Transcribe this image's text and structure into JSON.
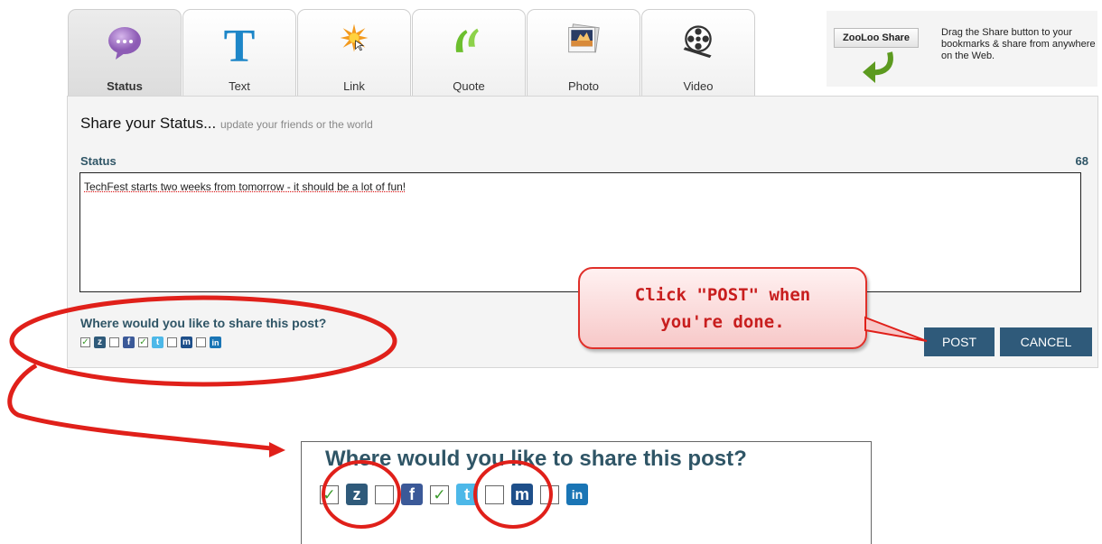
{
  "tabs": [
    {
      "label": "Status",
      "icon": "status-bubble-icon",
      "active": true
    },
    {
      "label": "Text",
      "icon": "text-t-icon",
      "active": false
    },
    {
      "label": "Link",
      "icon": "link-star-icon",
      "active": false
    },
    {
      "label": "Quote",
      "icon": "quote-marks-icon",
      "active": false
    },
    {
      "label": "Photo",
      "icon": "photo-icon",
      "active": false
    },
    {
      "label": "Video",
      "icon": "film-reel-icon",
      "active": false
    }
  ],
  "zooloo": {
    "button_label": "ZooLoo Share",
    "description": "Drag the Share button to your bookmarks & share from anywhere on the Web."
  },
  "form": {
    "heading": "Share your Status...",
    "subheading": "update your friends or the world",
    "status_label": "Status",
    "char_count": "68",
    "status_value": "TechFest starts two weeks from tomorrow - it should be a lot of fun!"
  },
  "share": {
    "question": "Where would you like to share this post?",
    "services": [
      {
        "name": "ZooLoo",
        "glyph": "z",
        "checked": true,
        "color": "#2f5a7a"
      },
      {
        "name": "Facebook",
        "glyph": "f",
        "checked": false,
        "color": "#3b5998"
      },
      {
        "name": "Twitter",
        "glyph": "t",
        "checked": true,
        "color": "#4db8e8"
      },
      {
        "name": "MySpace",
        "glyph": "m",
        "checked": false,
        "color": "#1e4f8a"
      },
      {
        "name": "LinkedIn",
        "glyph": "in",
        "checked": false,
        "color": "#1a75b5"
      }
    ]
  },
  "actions": {
    "post_label": "POST",
    "cancel_label": "CANCEL"
  },
  "callout": {
    "line1": "Click \"POST\" when",
    "line2": "you're done."
  },
  "zoom": {
    "question": "Where would you like to share this post?"
  },
  "colors": {
    "accent": "#2f5a7a",
    "annotation": "#e0201a",
    "label": "#2f5566"
  }
}
